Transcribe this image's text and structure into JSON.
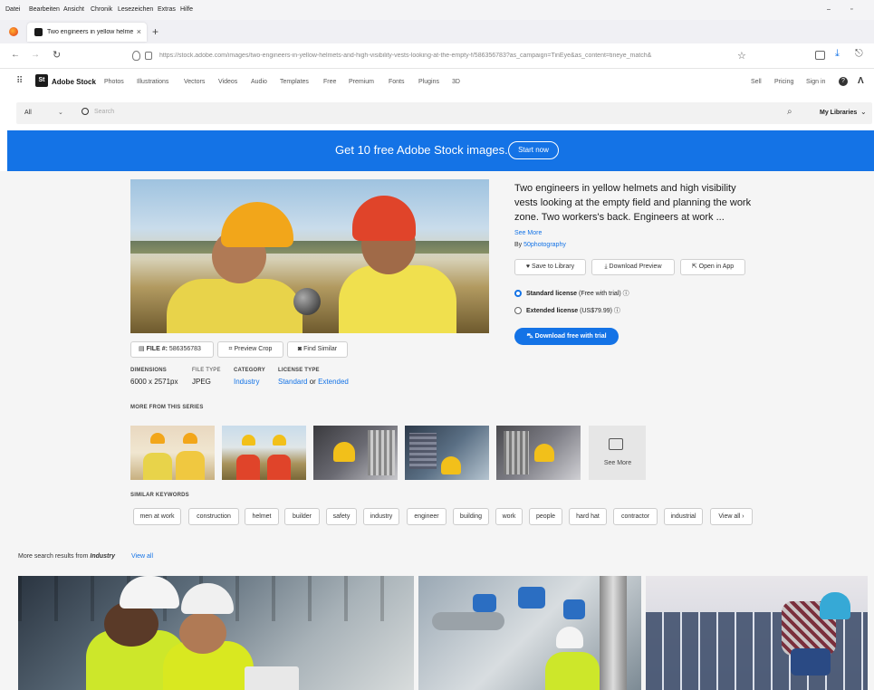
{
  "menu": [
    "Datei",
    "Bearbeiten",
    "Ansicht",
    "Chronik",
    "Lesezeichen",
    "Extras",
    "Hilfe"
  ],
  "tab": {
    "title": "Two engineers in yellow helme"
  },
  "url": "https://stock.adobe.com/images/two-engineers-in-yellow-helmets-and-high-visibility-vests-looking-at-the-empty-f/586356783?as_campaign=TinEye&as_content=tineye_match&",
  "nav": {
    "brand": "Adobe Stock",
    "logo": "St",
    "items": [
      "Photos",
      "Illustrations",
      "Vectors",
      "Videos",
      "Audio",
      "Templates",
      "Free",
      "Premium",
      "Fonts",
      "Plugins",
      "3D"
    ],
    "right": [
      "Sell",
      "Pricing",
      "Sign in"
    ]
  },
  "search": {
    "scope": "All",
    "placeholder": "Search",
    "libraries": "My Libraries"
  },
  "banner": {
    "text": "Get 10 free Adobe Stock images.",
    "button": "Start now"
  },
  "asset": {
    "title": "Two engineers in yellow helmets and high visibility vests looking at the empty field and planning the work zone. Two workers's back. Engineers at work ...",
    "see_more": "See More",
    "by_prefix": "By",
    "author": "50photography",
    "save": "Save to Library",
    "download_preview": "Download Preview",
    "open_in_app": "Open in App",
    "standard_license": "Standard license",
    "standard_note": "(Free with trial)",
    "extended_license": "Extended license",
    "extended_note": "(US$79.99)",
    "download_button": "Download free with trial",
    "file_label": "FILE #:",
    "file_no": "586356783",
    "preview_crop": "Preview Crop",
    "find_similar": "Find Similar",
    "dimensions_label": "DIMENSIONS",
    "dimensions": "6000 x 2571px",
    "filetype_label": "FILE TYPE",
    "filetype": "JPEG",
    "category_label": "CATEGORY",
    "category": "Industry",
    "license_label": "LICENSE TYPE",
    "license_standard": "Standard",
    "license_or": "or",
    "license_extended": "Extended"
  },
  "series": {
    "heading": "MORE FROM THIS SERIES",
    "see_more": "See More"
  },
  "keywords": {
    "heading": "SIMILAR KEYWORDS",
    "items": [
      "men at work",
      "construction",
      "helmet",
      "builder",
      "safety",
      "industry",
      "engineer",
      "building",
      "work",
      "people",
      "hard hat",
      "contractor",
      "industrial"
    ],
    "view_all": "View all ›"
  },
  "more_results": {
    "prefix": "More search results from",
    "category": "Industry",
    "view_all": "View all"
  },
  "colors": {
    "accent": "#1473e6",
    "banner": "#1473e6"
  }
}
